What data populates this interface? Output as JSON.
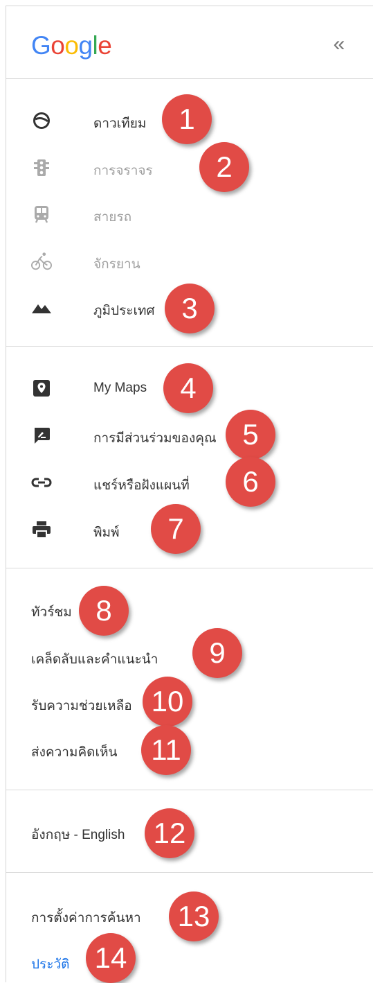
{
  "header": {
    "logo_letters": [
      {
        "ch": "G",
        "color": "#4285F4"
      },
      {
        "ch": "o",
        "color": "#EA4335"
      },
      {
        "ch": "o",
        "color": "#FBBC05"
      },
      {
        "ch": "g",
        "color": "#4285F4"
      },
      {
        "ch": "l",
        "color": "#34A853"
      },
      {
        "ch": "e",
        "color": "#EA4335"
      }
    ],
    "collapse_label": "«"
  },
  "layers": [
    {
      "label": "ดาวเทียม",
      "icon": "satellite-globe-icon",
      "enabled": true
    },
    {
      "label": "การจราจร",
      "icon": "traffic-light-icon",
      "enabled": false
    },
    {
      "label": "สายรถ",
      "icon": "transit-icon",
      "enabled": false
    },
    {
      "label": "จักรยาน",
      "icon": "bicycle-icon",
      "enabled": false
    },
    {
      "label": "ภูมิประเทศ",
      "icon": "terrain-icon",
      "enabled": true
    }
  ],
  "tools": [
    {
      "label": "My Maps",
      "icon": "my-maps-pin-icon"
    },
    {
      "label": "การมีส่วนร่วมของคุณ",
      "icon": "contributions-icon"
    },
    {
      "label": "แชร์หรือฝังแผนที่",
      "icon": "link-icon"
    },
    {
      "label": "พิมพ์",
      "icon": "print-icon"
    }
  ],
  "help": [
    {
      "label": "ทัวร์ชม"
    },
    {
      "label": "เคล็ดลับและคำแนะนำ"
    },
    {
      "label": "รับความช่วยเหลือ"
    },
    {
      "label": "ส่งความคิดเห็น"
    }
  ],
  "language": {
    "label": "อังกฤษ - English"
  },
  "footer": {
    "search_settings": "การตั้งค่าการค้นหา",
    "history": "ประวัติ"
  },
  "badges": [
    "1",
    "2",
    "3",
    "4",
    "5",
    "6",
    "7",
    "8",
    "9",
    "10",
    "11",
    "12",
    "13",
    "14"
  ],
  "colors": {
    "badge": "#E14B46",
    "text": "#333333",
    "disabled_text": "#9E9E9E",
    "icon_dark": "#333333",
    "icon_disabled": "#AAAAAA",
    "link": "#1A73E8",
    "divider": "#D9D9D9"
  }
}
